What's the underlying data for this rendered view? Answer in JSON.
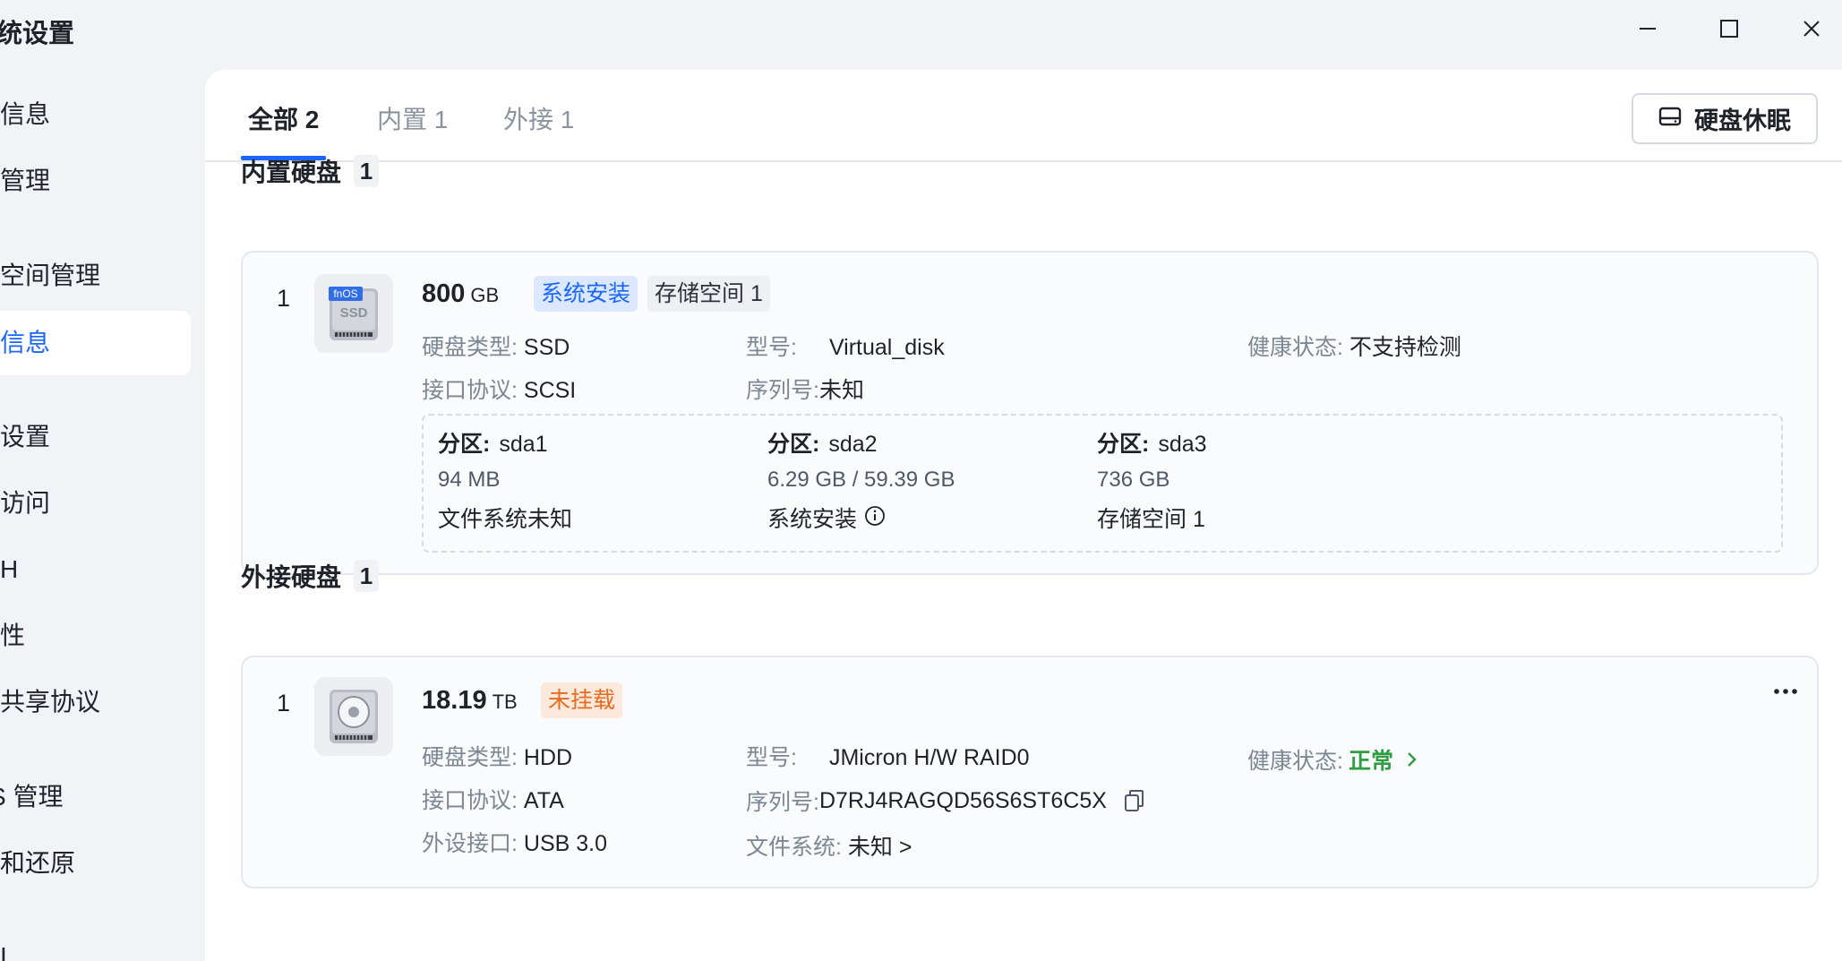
{
  "window": {
    "title": "统设置",
    "minimize_icon": "minimize-icon",
    "maximize_icon": "maximize-icon",
    "close_icon": "close-icon"
  },
  "sidebar": {
    "items": [
      {
        "label": "信息"
      },
      {
        "label": "管理"
      },
      {
        "label": "空间管理"
      },
      {
        "label": "信息",
        "active": true
      },
      {
        "label": "设置"
      },
      {
        "label": "访问"
      },
      {
        "label": "H"
      },
      {
        "label": "性"
      },
      {
        "label": "共享协议"
      },
      {
        "label": "管理"
      },
      {
        "label": "和还原"
      },
      {
        "label": "I"
      }
    ]
  },
  "tabs": [
    {
      "label": "全部 2",
      "active": true
    },
    {
      "label": "内置 1"
    },
    {
      "label": "外接 1"
    }
  ],
  "sleep_button": {
    "label": "硬盘休眠",
    "icon": "hard-drive-icon"
  },
  "internal": {
    "title": "内置硬盘",
    "count": "1",
    "disk": {
      "index": "1",
      "icon": "ssd-icon",
      "icon_text_top": "fnOS",
      "icon_text": "SSD",
      "capacity": "800",
      "unit": "GB",
      "tags": [
        "系统安装",
        "存储空间 1"
      ],
      "type_label": "硬盘类型:",
      "type_value": "SSD",
      "iface_label": "接口协议:",
      "iface_value": "SCSI",
      "model_label": "型号:",
      "model_value": "Virtual_disk",
      "serial_label": "序列号:",
      "serial_value": "未知",
      "health_label": "健康状态:",
      "health_value": "不支持检测",
      "partitions": [
        {
          "label": "分区:",
          "name": "sda1",
          "size": "94 MB",
          "usage": "文件系统未知"
        },
        {
          "label": "分区:",
          "name": "sda2",
          "size": "6.29 GB / 59.39 GB",
          "usage": "系统安装",
          "info_icon": "info-icon"
        },
        {
          "label": "分区:",
          "name": "sda3",
          "size": "736 GB",
          "usage": "存储空间 1"
        }
      ]
    }
  },
  "external": {
    "title": "外接硬盘",
    "count": "1",
    "disk": {
      "index": "1",
      "icon": "hdd-icon",
      "capacity": "18.19",
      "unit": "TB",
      "tag": "未挂载",
      "type_label": "硬盘类型:",
      "type_value": "HDD",
      "iface_label": "接口协议:",
      "iface_value": "ATA",
      "port_label": "外设接口:",
      "port_value": "USB 3.0",
      "model_label": "型号:",
      "model_value": "JMicron H/W RAID0",
      "serial_label": "序列号:",
      "serial_value": "D7RJ4RAGQD56S6ST6C5X",
      "fs_label": "文件系统:",
      "fs_value": "未知 >",
      "health_label": "健康状态:",
      "health_value": "正常",
      "more_icon": "more-icon",
      "copy_icon": "copy-icon"
    }
  },
  "colors": {
    "accent": "#1a66ff",
    "tag_blue_bg": "#dbe8ff",
    "tag_blue_fg": "#1a66ff",
    "tag_orange_bg": "#fde9dc",
    "tag_orange_fg": "#e86a1e",
    "healthy_green": "#2e9e45"
  }
}
